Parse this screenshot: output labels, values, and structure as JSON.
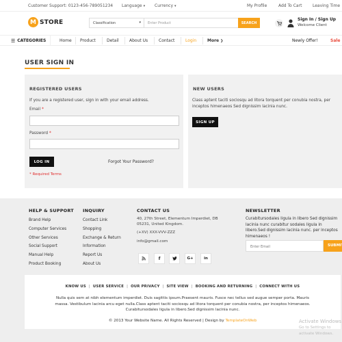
{
  "topbar": {
    "contact": "Customer Support: 0123-456-789051234",
    "language": "Language",
    "currency": "Currency",
    "links": [
      "My Profile",
      "Add To Cart",
      "Leaving Time"
    ]
  },
  "header": {
    "logo_letter": "M",
    "logo_text": "STORE",
    "search_category": "Classification",
    "search_placeholder": "Enter Product",
    "search_button": "SEARCH",
    "signin": "Sign In / Sign Up",
    "welcome": "Welcome Client"
  },
  "nav": {
    "categories": "CATEGORIES",
    "items": [
      "Home",
      "Product",
      "Detail",
      "About Us",
      "Contact",
      "Login",
      "More"
    ],
    "newly": "Newly Offer!",
    "sale": "Sale"
  },
  "page": {
    "title": "USER SIGN IN"
  },
  "registered": {
    "heading": "REGISTERED USERS",
    "intro": "If you are a registered user, sign in with your email address.",
    "email_label": "Email",
    "password_label": "Password",
    "asterisk": "*",
    "login_button": "LOG IN",
    "forgot": "Forgot Your Password?",
    "required": "* Required Terms"
  },
  "new_users": {
    "heading": "NEW USERS",
    "text": "Class aptent taciti sociosqu ad litora torquent per conubia nostra, per inceptos himenaeos Sed dignissim lacinia nunc.",
    "signup_button": "SIGN UP"
  },
  "footer": {
    "help": {
      "title": "HELP & SUPPORT",
      "items": [
        "Brand Help",
        "Computer Services",
        "Other Services",
        "Social Support",
        "Manual Help",
        "Product Booking"
      ]
    },
    "inquiry": {
      "title": "INQUIRY",
      "items": [
        "Contact Link",
        "Shopping",
        "Exchange & Return",
        "Information",
        "Report Us",
        "About Us"
      ]
    },
    "contact": {
      "title": "CONTACT US",
      "address1": "40, 27th Street, Elementum Imperdiet, DB",
      "address2": "05231, United Kingdom.",
      "phone": "(+XV) XXX-VVV-ZZZ",
      "email": "info@gmail.com"
    },
    "social": [
      "rss-icon",
      "facebook-icon",
      "twitter-icon",
      "google-plus-icon",
      "linkedin-icon"
    ],
    "newsletter": {
      "title": "NEWSLETTER",
      "text": "Curabitursodales ligula in libero Sed dignissim lacinia nunc curabitur sodales ligula in libero.Sed dignissim lacinia nunc. per inceptos himenaeos !",
      "placeholder": "Enter Email",
      "button": "SUBMIT"
    }
  },
  "bottom": {
    "links": [
      "KNOW US",
      "USER SERVICE",
      "OUR PRIVACY",
      "SITE VIEW",
      "BOOKING AND RETURNING",
      "CONNECT WITH US"
    ],
    "separator": "|",
    "description": "Nulla quis sem at nibh elementum imperdiet. Duis sagittis ipsum.Praesent mauris. Fusce nec tellus sed augue semper porta. Mauris massa. Vestibulum lacinia arcu eget nulla.Class aptent taciti sociosqu ad litora torquent per conubia nostra, per inceptos himenaeos. Curabitursodales ligula in libero.Sed dignissim lacinia nunc.",
    "copyright": "© 2013 Your Website Name. All Rights Reserved | Design by",
    "designer": "TemplateOnWeb"
  },
  "watermark": {
    "line1": "Activate Windows",
    "line2": "Go to Settings to activate Windows."
  },
  "colors": {
    "accent": "#f7a21b",
    "required": "#e02c2c",
    "panel": "#f1f1f1",
    "footer": "#eeeeee"
  }
}
